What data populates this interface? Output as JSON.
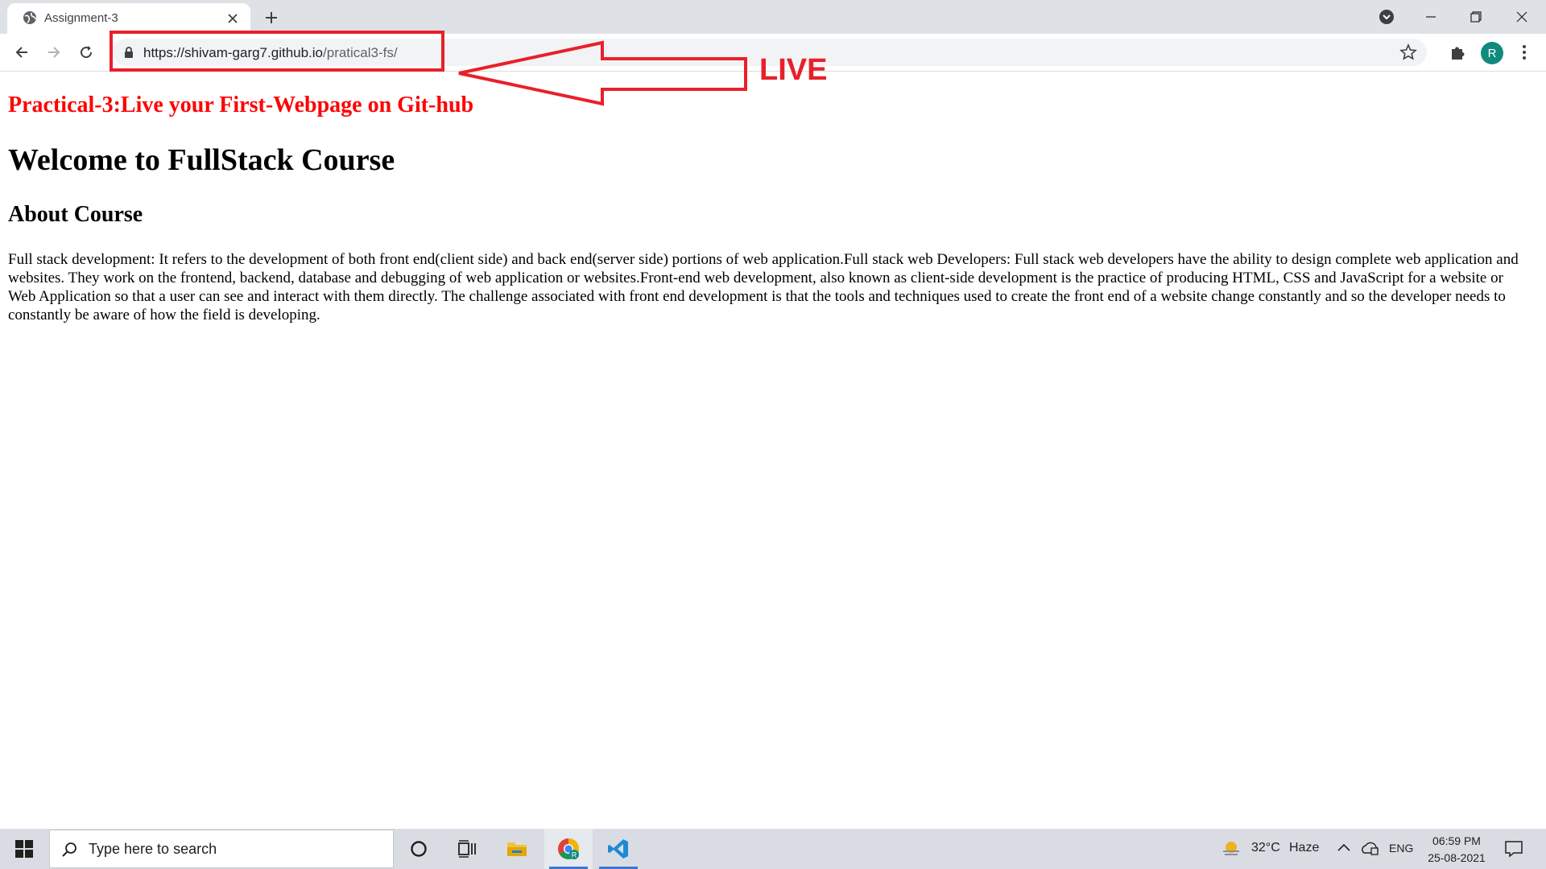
{
  "browser": {
    "tab_title": "Assignment-3",
    "url_host": "https://shivam-garg7.github.io",
    "url_path": "/pratical3-fs/",
    "profile_initial": "R"
  },
  "annotation": {
    "label": "LIVE",
    "color": "#e8202a"
  },
  "page": {
    "practical_heading": "Practical-3:Live your First-Webpage on Git-hub",
    "main_heading": "Welcome to FullStack Course",
    "sub_heading": "About Course",
    "paragraph": "Full stack development: It refers to the development of both front end(client side) and back end(server side) portions of web application.Full stack web Developers: Full stack web developers have the ability to design complete web application and websites. They work on the frontend, backend, database and debugging of web application or websites.Front-end web development, also known as client-side development is the practice of producing HTML, CSS and JavaScript for a website or Web Application so that a user can see and interact with them directly. The challenge associated with front end development is that the tools and techniques used to create the front end of a website change constantly and so the developer needs to constantly be aware of how the field is developing."
  },
  "taskbar": {
    "search_placeholder": "Type here to search",
    "weather_temp": "32°C",
    "weather_desc": "Haze",
    "language": "ENG",
    "time": "06:59 PM",
    "date": "25-08-2021"
  }
}
